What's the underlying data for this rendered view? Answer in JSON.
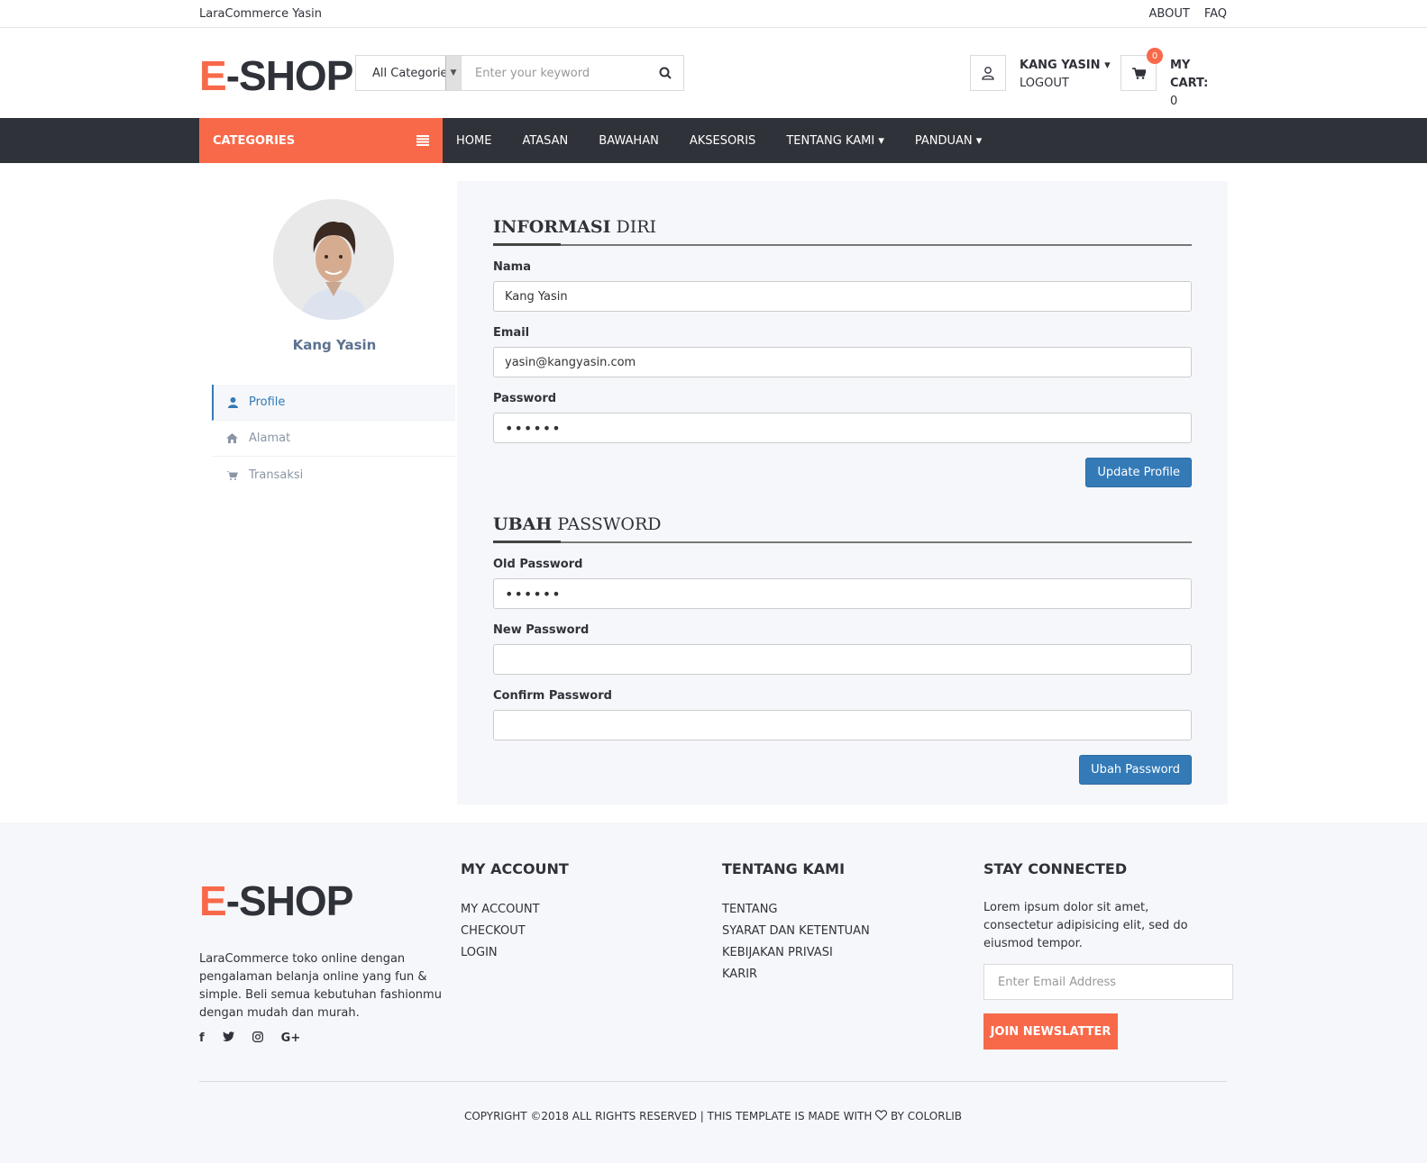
{
  "topbar": {
    "site_name": "LaraCommerce Yasin",
    "links": [
      "ABOUT",
      "FAQ"
    ]
  },
  "header": {
    "logo_accent": "E",
    "logo_rest": "-SHOP",
    "search": {
      "category": "All Categories",
      "placeholder": "Enter your keyword"
    },
    "account": {
      "name": "KANG YASIN",
      "logout": "LOGOUT"
    },
    "cart": {
      "label": "MY CART:",
      "amount": "0",
      "count": "0"
    }
  },
  "nav": {
    "categories": "CATEGORIES",
    "items": [
      "HOME",
      "ATASAN",
      "BAWAHAN",
      "AKSESORIS",
      "TENTANG KAMI",
      "PANDUAN"
    ]
  },
  "sidebar": {
    "user_name": "Kang Yasin",
    "items": [
      {
        "label": "Profile",
        "icon": "user-icon",
        "active": true
      },
      {
        "label": "Alamat",
        "icon": "home-icon",
        "active": false
      },
      {
        "label": "Transaksi",
        "icon": "cart-icon",
        "active": false
      }
    ]
  },
  "profile": {
    "title_bold": "INFORMASI",
    "title_rest": "DIRI",
    "name_label": "Nama",
    "name_value": "Kang Yasin",
    "email_label": "Email",
    "email_value": "yasin@kangyasin.com",
    "password_label": "Password",
    "password_value": "••••••",
    "submit": "Update Profile"
  },
  "change_password": {
    "title_bold": "UBAH",
    "title_rest": "PASSWORD",
    "old_label": "Old Password",
    "old_value": "••••••",
    "new_label": "New Password",
    "new_value": "",
    "confirm_label": "Confirm Password",
    "confirm_value": "",
    "submit": "Ubah Password"
  },
  "footer": {
    "logo_accent": "E",
    "logo_rest": "-SHOP",
    "description": "LaraCommerce toko online dengan pengalaman belanja online yang fun & simple. Beli semua kebutuhan fashionmu dengan mudah dan murah.",
    "social": [
      "facebook-icon",
      "twitter-icon",
      "instagram-icon",
      "google-plus-icon"
    ],
    "my_account": {
      "title": "MY ACCOUNT",
      "links": [
        "MY ACCOUNT",
        "CHECKOUT",
        "LOGIN"
      ]
    },
    "tentang": {
      "title": "TENTANG KAMI",
      "links": [
        "TENTANG",
        "SYARAT DAN KETENTUAN",
        "KEBIJAKAN PRIVASI",
        "KARIR"
      ]
    },
    "stay": {
      "title": "STAY CONNECTED",
      "text": "Lorem ipsum dolor sit amet, consectetur adipisicing elit, sed do eiusmod tempor.",
      "placeholder": "Enter Email Address",
      "button": "JOIN NEWSLATTER"
    },
    "copyright_left": "COPYRIGHT ©2018 ALL RIGHTS RESERVED | THIS TEMPLATE IS MADE WITH",
    "copyright_right": "BY COLORLIB"
  },
  "colors": {
    "accent": "#f8694a",
    "nav_bg": "#30323a",
    "primary_button": "#337ab7"
  }
}
